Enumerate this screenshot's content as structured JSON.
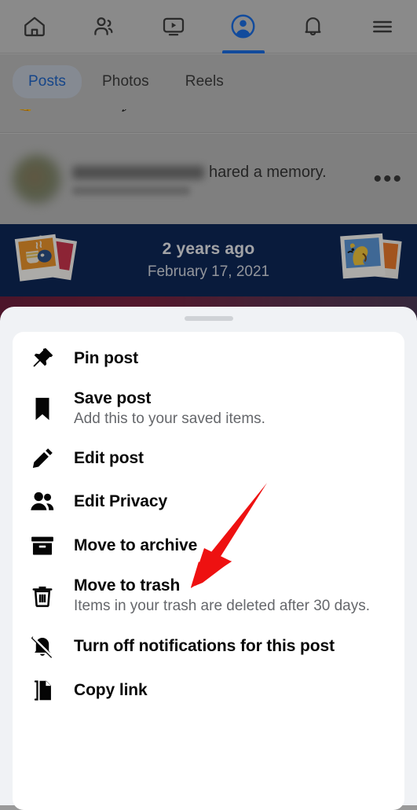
{
  "top_nav": {
    "items": [
      {
        "name": "home-icon",
        "label": "Home",
        "active": false
      },
      {
        "name": "friends-icon",
        "label": "Friends",
        "active": false
      },
      {
        "name": "video-icon",
        "label": "Video",
        "active": false
      },
      {
        "name": "profile-icon",
        "label": "Profile",
        "active": true
      },
      {
        "name": "notifications-icon",
        "label": "Notifications",
        "active": false
      },
      {
        "name": "menu-icon",
        "label": "Menu",
        "active": false
      }
    ],
    "active_color": "#1b6ce0"
  },
  "profile_tabs": {
    "items": [
      {
        "label": "Posts",
        "active": true
      },
      {
        "label": "Photos",
        "active": false
      },
      {
        "label": "Reels",
        "active": false
      }
    ],
    "active_text_color": "#1f63c4"
  },
  "post": {
    "author_name": "",
    "action_text": "hared a memory.",
    "overflow_label": "•••"
  },
  "memory_banner": {
    "title": "2 years ago",
    "date": "February 17, 2021",
    "background_color": "#0d2757",
    "left_art": "photo-stack-coffee-icon",
    "right_art": "photo-stack-dog-icon"
  },
  "sheet": {
    "handle": "drag-handle",
    "menu_items": [
      {
        "icon": "pin-icon",
        "title": "Pin post",
        "subtitle": ""
      },
      {
        "icon": "bookmark-icon",
        "title": "Save post",
        "subtitle": "Add this to your saved items."
      },
      {
        "icon": "pencil-icon",
        "title": "Edit post",
        "subtitle": ""
      },
      {
        "icon": "people-icon",
        "title": "Edit Privacy",
        "subtitle": ""
      },
      {
        "icon": "archive-box-icon",
        "title": "Move to archive",
        "subtitle": ""
      },
      {
        "icon": "trash-icon",
        "title": "Move to trash",
        "subtitle": "Items in your trash are deleted after 30 days."
      },
      {
        "icon": "bell-slash-icon",
        "title": "Turn off notifications for this post",
        "subtitle": ""
      },
      {
        "icon": "copy-link-icon",
        "title": "Copy link",
        "subtitle": ""
      }
    ]
  },
  "annotation": {
    "arrow_color": "#ee1111",
    "points_to": "Move to archive"
  }
}
